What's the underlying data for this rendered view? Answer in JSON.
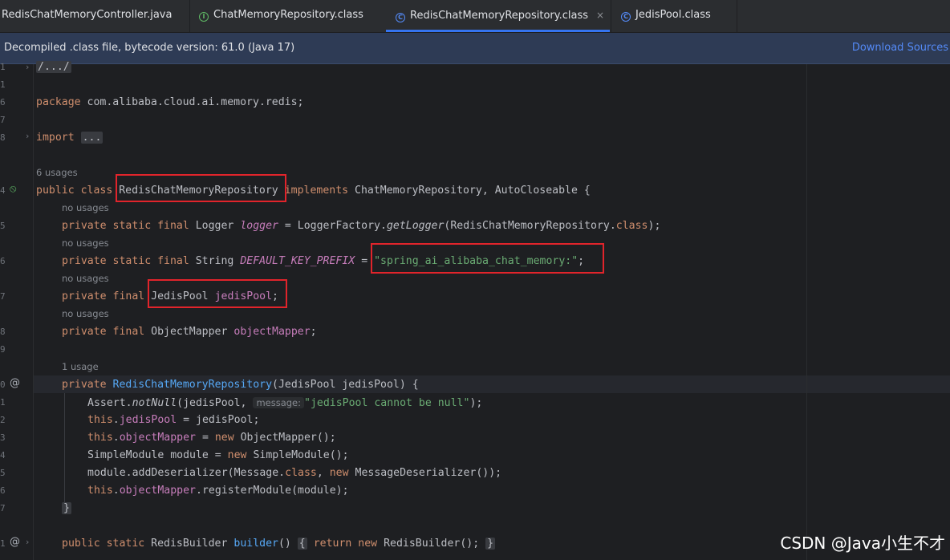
{
  "tabs": [
    {
      "label": "RedisChatMemoryController.java",
      "icon": "java-file-icon",
      "active": false
    },
    {
      "label": "ChatMemoryRepository.class",
      "icon": "interface-icon",
      "active": false
    },
    {
      "label": "RedisChatMemoryRepository.class",
      "icon": "class-icon",
      "active": true,
      "close": "×"
    },
    {
      "label": "JedisPool.class",
      "icon": "class-icon",
      "active": false
    }
  ],
  "banner": {
    "text": "Decompiled .class file, bytecode version: 61.0 (Java 17)",
    "link": "Download Sources"
  },
  "gutter": {
    "line_numbers": [
      "1",
      "1",
      "6",
      "7",
      "8",
      "4",
      "5",
      "6",
      "7",
      "8",
      "9",
      "0",
      "1",
      "2",
      "3",
      "4",
      "5",
      "6",
      "7",
      "1"
    ]
  },
  "code": {
    "l_header": "/.../",
    "l_package_kw": "package",
    "l_package_name": " com.alibaba.cloud.ai.memory.redis;",
    "l_import_kw": "import",
    "l_import_fold": "...",
    "usages_6": "6 usages",
    "class_public": "public class",
    "class_name": "RedisChatMemoryRepository",
    "class_implements": "implements",
    "class_ifaces": " ChatMemoryRepository, AutoCloseable {",
    "no_usages": "no usages",
    "logger_mods": "private static final",
    "logger_type": " Logger ",
    "logger_name": "logger",
    "logger_eq": " = LoggerFactory.",
    "logger_method": "getLogger",
    "logger_arg": "(RedisChatMemoryRepository.",
    "logger_class": "class",
    "logger_end": ");",
    "prefix_mods": "private static final",
    "prefix_type": " String ",
    "prefix_name": "DEFAULT_KEY_PREFIX",
    "prefix_eq": " = ",
    "prefix_value": "\"spring_ai_alibaba_chat_memory:\"",
    "prefix_end": ";",
    "pool_mods": "private final",
    "pool_type": " JedisPool ",
    "pool_name": "jedisPool",
    "pool_end": ";",
    "mapper_mods": "private final",
    "mapper_type": " ObjectMapper ",
    "mapper_name": "objectMapper",
    "mapper_end": ";",
    "usage_1": "1 usage",
    "ctor_mod": "private",
    "ctor_name": "RedisChatMemoryRepository",
    "ctor_params": "(JedisPool jedisPool) {",
    "assert_a": "Assert.",
    "assert_m": "notNull",
    "assert_b": "(jedisPool, ",
    "assert_hint": "message:",
    "assert_str": "\"jedisPool cannot be null\"",
    "assert_end": ");",
    "this_kw": "this",
    "pool_assign_field": "jedisPool",
    "pool_assign_rest": " = jedisPool;",
    "mapper_assign_field": "objectMapper",
    "mapper_assign_eq": " = ",
    "new_kw": "new",
    "mapper_assign_rest": " ObjectMapper();",
    "module_a": "SimpleModule module = ",
    "module_rest": " SimpleModule();",
    "deser_a": "module.addDeserializer(Message.",
    "deser_class": "class",
    "deser_b": ", ",
    "deser_rest": " MessageDeserializer());",
    "reg_field": "objectMapper",
    "reg_rest": ".registerModule(module);",
    "close_brace": "}",
    "builder_mods": "public static",
    "builder_type": " RedisBuilder ",
    "builder_name": "builder",
    "builder_paren": "()",
    "builder_open": "{",
    "builder_return": "return",
    "builder_rest": " RedisBuilder();",
    "builder_close": "}"
  },
  "watermark": "CSDN @Java小生不才",
  "colors": {
    "highlight_box": "#e1242b",
    "keyword": "#cf8e6d",
    "string": "#6aab73",
    "field": "#c77dbb",
    "method": "#56a8f5"
  }
}
